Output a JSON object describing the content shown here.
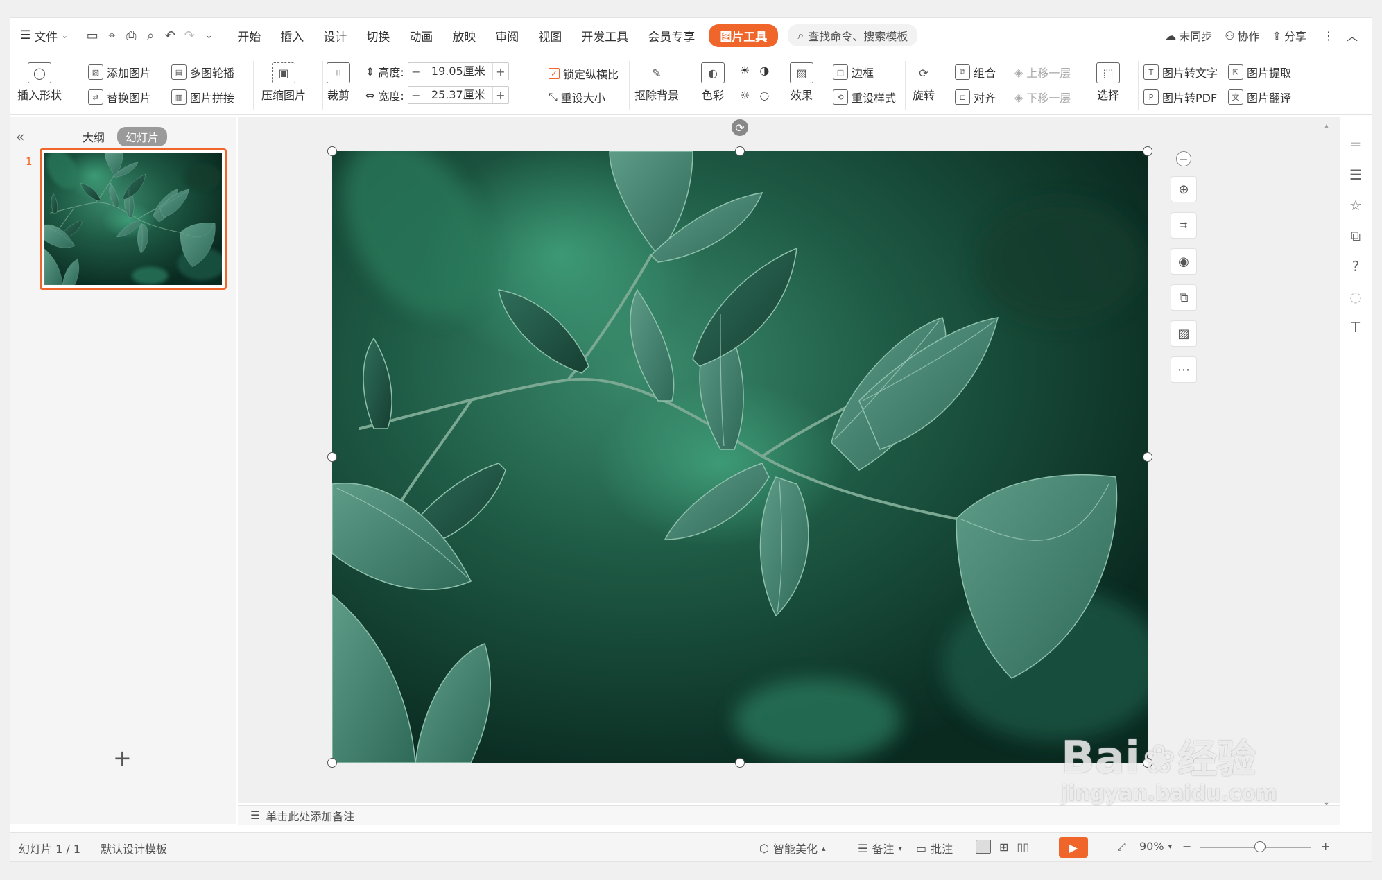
{
  "menubar": {
    "file_label": "文件",
    "tabs": [
      "开始",
      "插入",
      "设计",
      "切换",
      "动画",
      "放映",
      "审阅",
      "视图",
      "开发工具",
      "会员专享"
    ],
    "active_tab": "图片工具",
    "search_placeholder": "查找命令、搜索模板",
    "right": {
      "sync": "未同步",
      "collab": "协作",
      "share": "分享"
    }
  },
  "ribbon": {
    "insert_shape": "插入形状",
    "add_picture": "添加图片",
    "replace_picture": "替换图片",
    "multi_carousel": "多图轮播",
    "picture_collage": "图片拼接",
    "compress_picture": "压缩图片",
    "crop": "裁剪",
    "height_label": "高度:",
    "height_value": "19.05厘米",
    "width_label": "宽度:",
    "width_value": "25.37厘米",
    "lock_ratio": "锁定纵横比",
    "reset_size": "重设大小",
    "remove_bg": "抠除背景",
    "color": "色彩",
    "effect": "效果",
    "border": "边框",
    "reset_style": "重设样式",
    "rotate": "旋转",
    "group": "组合",
    "align": "对齐",
    "bring_forward": "上移一层",
    "send_backward": "下移一层",
    "select": "选择",
    "pic_to_text": "图片转文字",
    "pic_to_pdf": "图片转PDF",
    "pic_extract": "图片提取",
    "pic_translate": "图片翻译"
  },
  "leftpanel": {
    "outline_tab": "大纲",
    "slides_tab": "幻灯片",
    "slide_number": "1"
  },
  "notes": {
    "placeholder": "单击此处添加备注"
  },
  "statusbar": {
    "slide_info": "幻灯片 1 / 1",
    "template": "默认设计模板",
    "smart_beautify": "智能美化",
    "notes": "备注",
    "comments": "批注",
    "zoom": "90%"
  },
  "watermark": {
    "brand": "Bai",
    "brand_cn": "经验",
    "url": "jingyan.baidu.com"
  },
  "colors": {
    "accent": "#f0652a",
    "leaf_dark": "#0f3a2c",
    "leaf_light": "#4f8f7a"
  }
}
